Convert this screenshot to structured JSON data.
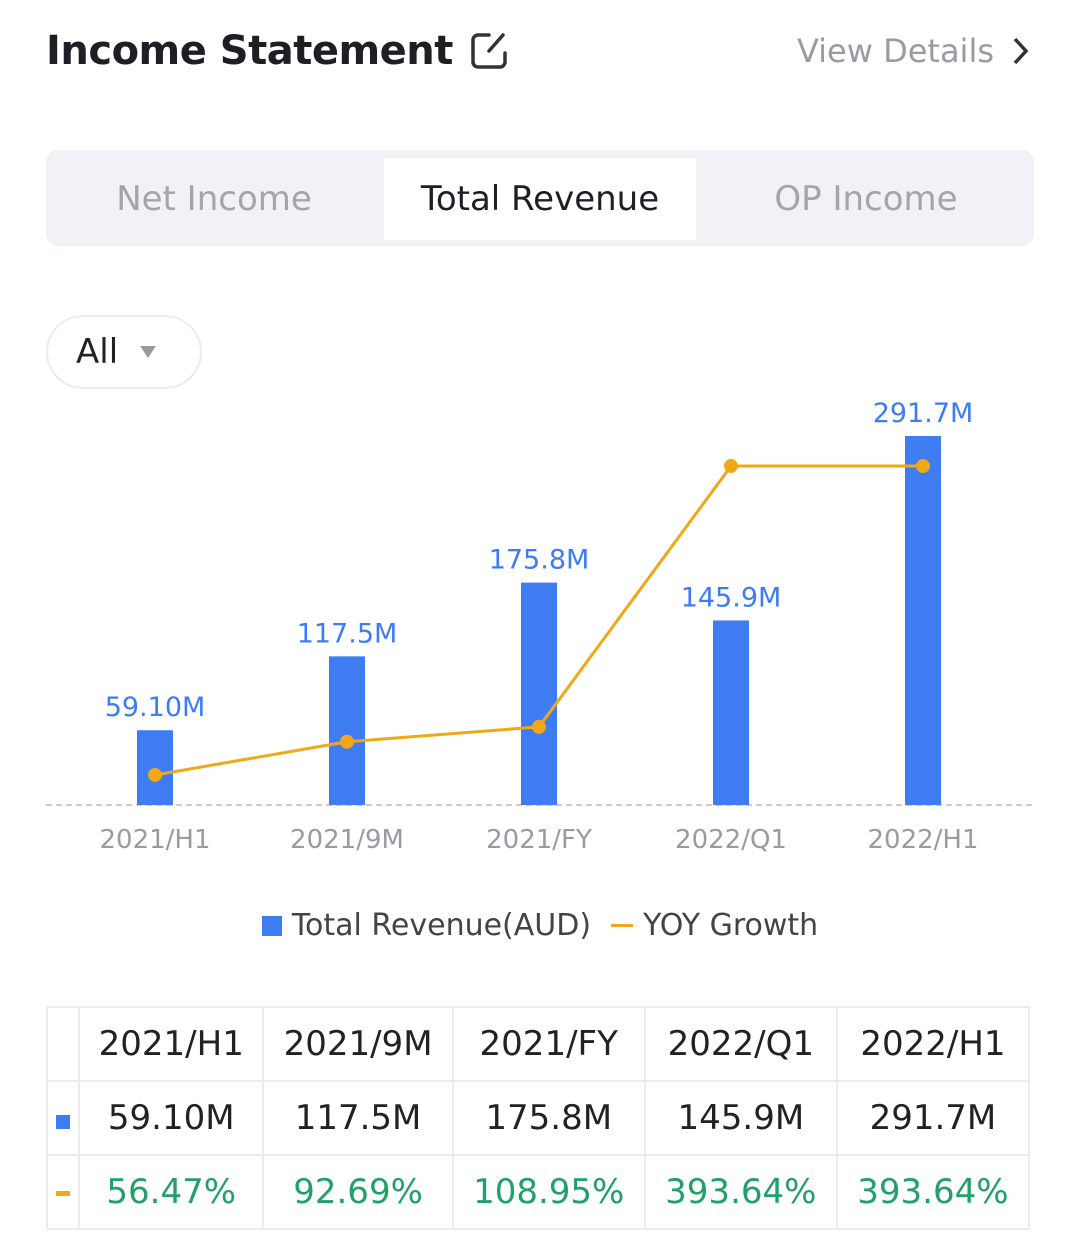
{
  "header": {
    "title": "Income Statement",
    "view_details": "View Details"
  },
  "tabs": [
    {
      "label": "Net Income"
    },
    {
      "label": "Total Revenue",
      "active": true
    },
    {
      "label": "OP Income"
    }
  ],
  "filter": {
    "selected": "All"
  },
  "colors": {
    "bar": "#3d7cf1",
    "line": "#f0a818",
    "growth_text": "#21a06a"
  },
  "chart_data": {
    "type": "bar+line",
    "categories": [
      "2021/H1",
      "2021/9M",
      "2021/FY",
      "2022/Q1",
      "2022/H1"
    ],
    "series": [
      {
        "name": "Total Revenue(AUD)",
        "type": "bar",
        "values": [
          59.1,
          117.5,
          175.8,
          145.9,
          291.7
        ],
        "labels": [
          "59.10M",
          "117.5M",
          "175.8M",
          "145.9M",
          "291.7M"
        ],
        "ylim": [
          0,
          291.7
        ]
      },
      {
        "name": "YOY Growth",
        "type": "line",
        "values": [
          56.47,
          92.69,
          108.95,
          393.64,
          393.64
        ],
        "labels": [
          "56.47%",
          "92.69%",
          "108.95%",
          "393.64%",
          "393.64%"
        ],
        "ylim": [
          23.7,
          426.4
        ]
      }
    ],
    "legend": "bottom-center",
    "grid": false
  }
}
